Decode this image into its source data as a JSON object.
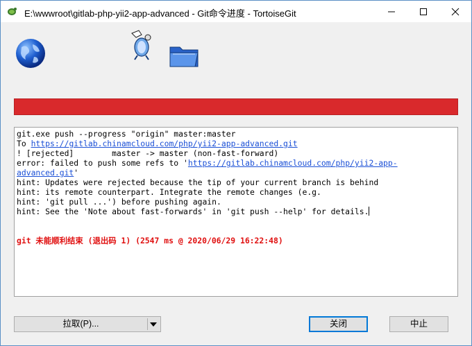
{
  "window": {
    "title": "E:\\wwwroot\\gitlab-php-yii2-app-advanced - Git命令进度 - TortoiseGit"
  },
  "titlebar_buttons": {
    "minimize_icon": "minimize-icon",
    "maximize_icon": "maximize-icon",
    "close_icon": "close-icon"
  },
  "progress": {
    "state": "error",
    "fraction": 1.0,
    "color": "#d9292c"
  },
  "log": {
    "lines": [
      {
        "text": "git.exe push --progress \"origin\" master:master"
      },
      {
        "prefix": "To ",
        "link": "https://gitlab.chinamcloud.com/php/yii2-app-advanced.git"
      },
      {
        "text": "! [rejected]        master -> master (non-fast-forward)"
      },
      {
        "prefix": "error: failed to push some refs to '",
        "link": "https://gitlab.chinamcloud.com/php/yii2-app-"
      },
      {
        "link": "advanced.git",
        "suffix": "'"
      },
      {
        "text": "hint: Updates were rejected because the tip of your current branch is behind"
      },
      {
        "text": "hint: its remote counterpart. Integrate the remote changes (e.g."
      },
      {
        "text": "hint: 'git pull ...') before pushing again."
      },
      {
        "text": "hint: See the 'Note about fast-forwards' in 'git push --help' for details."
      }
    ],
    "error_summary": "git 未能顺利结束 (退出码 1) (2547 ms @ 2020/06/29 16:22:48)",
    "link_color": "#1a4fd6",
    "error_color": "#e01010"
  },
  "buttons": {
    "pull": "拉取(P)...",
    "close": "关闭",
    "abort": "中止"
  }
}
